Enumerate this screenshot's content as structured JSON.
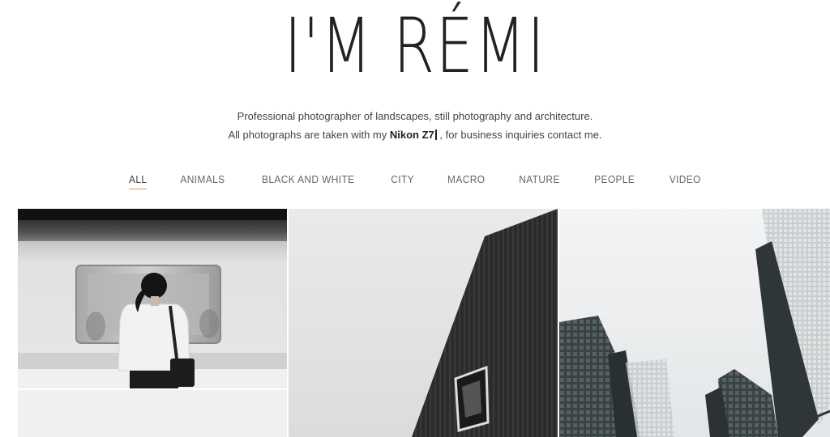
{
  "header": {
    "title": "I'M RÉMI",
    "tagline_line1": "Professional photographer of landscapes, still photography and architecture.",
    "tagline_line2_pre": "All photographs are taken with my ",
    "tagline_camera": "Nikon Z7",
    "tagline_line2_post": " , for business inquiries contact me."
  },
  "filters": {
    "all": "ALL",
    "animals": "ANIMALS",
    "bw": "BLACK AND WHITE",
    "city": "CITY",
    "macro": "MACRO",
    "nature": "NATURE",
    "people": "PEOPLE",
    "video": "VIDEO"
  },
  "colors": {
    "accent_underline": "#c9a45c"
  },
  "gallery": {
    "tiles": [
      "subway-woman-photo",
      "black-building-photo",
      "skyscrapers-photo",
      "light-gray-photo"
    ]
  }
}
